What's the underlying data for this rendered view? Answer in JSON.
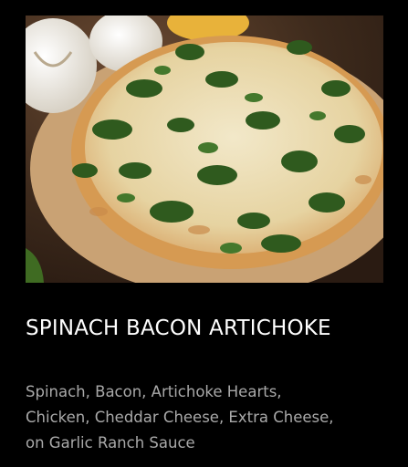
{
  "menu_item": {
    "image_alt": "Spinach bacon artichoke pizza",
    "title": "SPINACH BACON ARTICHOKE",
    "description_lines": [
      "Spinach, Bacon, Artichoke Hearts,",
      "Chicken, Cheddar Cheese, Extra Cheese,",
      "on Garlic Ranch Sauce"
    ]
  },
  "colors": {
    "background": "#000000",
    "title": "#ffffff",
    "description": "#a9a9a9"
  }
}
